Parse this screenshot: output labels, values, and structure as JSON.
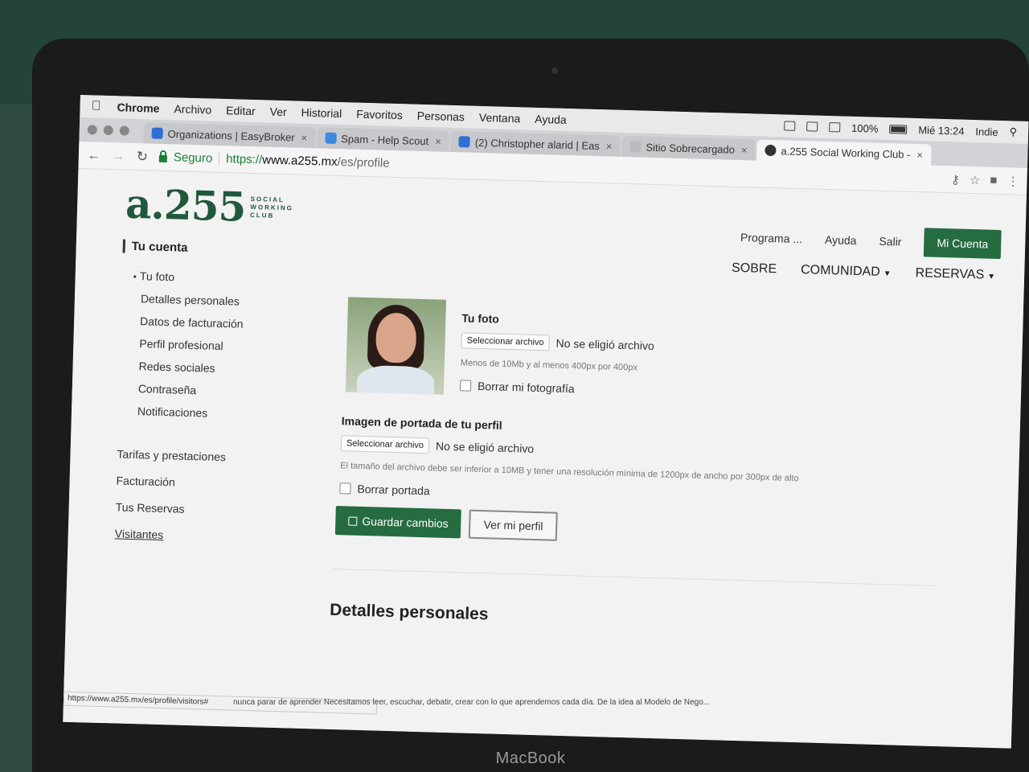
{
  "device": {
    "brand": "MacBook"
  },
  "menubar": {
    "app_name": "Chrome",
    "menus": [
      "Archivo",
      "Editar",
      "Ver",
      "Historial",
      "Favoritos",
      "Personas",
      "Ventana",
      "Ayuda"
    ],
    "battery": "100%",
    "clock": "Mié 13:24",
    "user": "Indie"
  },
  "tabs": [
    {
      "title": "Organizations | EasyBroker",
      "favicon_color": "#2f6fd6"
    },
    {
      "title": "Spam - Help Scout",
      "favicon_color": "#3a8ae0"
    },
    {
      "title": "(2) Christopher alarid | Eas",
      "favicon_color": "#2f6fd6"
    },
    {
      "title": "Sitio Sobrecargado",
      "favicon_color": "#bbbbbb"
    },
    {
      "title": "a.255 Social Working Club -",
      "favicon_color": "#333333"
    }
  ],
  "toolbar": {
    "secure_label": "Seguro",
    "url_scheme": "https://",
    "url_host": "www.a255.mx",
    "url_path": "/es/profile"
  },
  "site": {
    "logo_main": "a.255",
    "logo_sub": "SOCIAL WORKING CLUB",
    "nav_top": [
      "Programa ...",
      "Ayuda",
      "Salir"
    ],
    "account_button": "Mi Cuenta",
    "nav_main": [
      "SOBRE",
      "COMUNIDAD",
      "RESERVAS"
    ],
    "brand_color": "#256c41"
  },
  "sidebar": {
    "heading": "Tu cuenta",
    "sub_items": [
      "Tu foto",
      "Detalles personales",
      "Datos de facturación",
      "Perfil profesional",
      "Redes sociales",
      "Contraseña",
      "Notificaciones"
    ],
    "main_items": [
      "Tarifas y prestaciones",
      "Facturación",
      "Tus Reservas",
      "Visitantes"
    ]
  },
  "profile": {
    "photo_title": "Tu foto",
    "file_button": "Seleccionar archivo",
    "no_file": "No se eligió archivo",
    "photo_hint": "Menos de 10Mb y al menos 400px por 400px",
    "delete_photo": "Borrar mi fotografía",
    "cover_title": "Imagen de portada de tu perfil",
    "cover_hint": "El tamaño del archivo debe ser inferior a 10MB y tener una resolución mínima de 1200px de ancho por 300px de alto",
    "delete_cover": "Borrar portada",
    "save_button": "Guardar cambios",
    "view_button": "Ver mi perfil",
    "next_section": "Detalles personales"
  },
  "status_url": "https://www.a255.mx/es/profile/visitors#",
  "background_text": "nunca parar de aprender Necesitamos leer, escuchar, debatir, crear con lo que aprendemos cada día. De la idea al Modelo de Nego..."
}
